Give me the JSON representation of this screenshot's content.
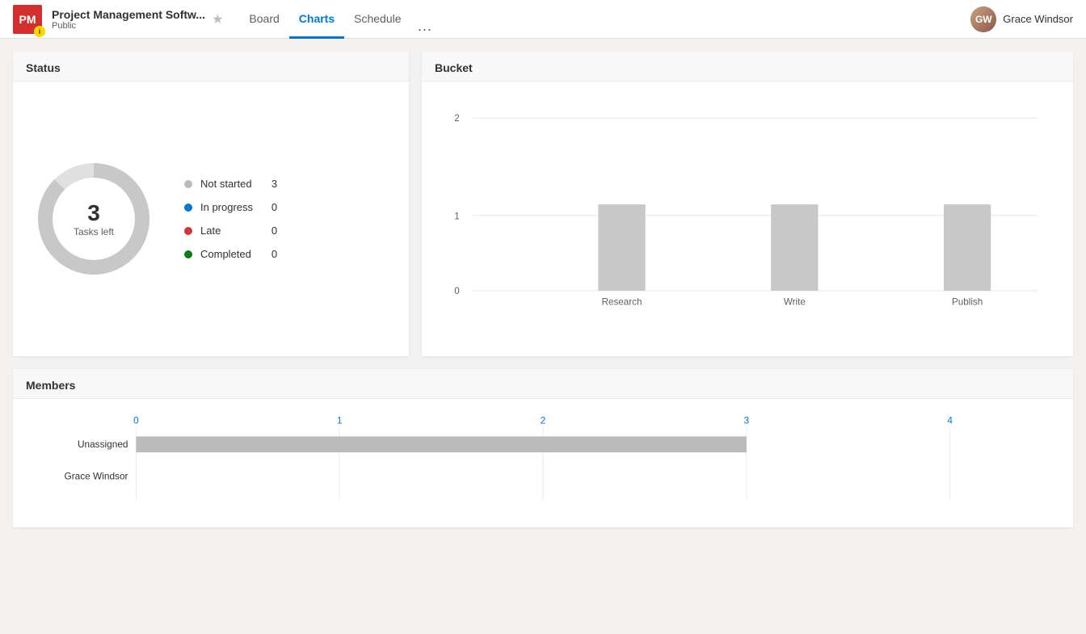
{
  "header": {
    "logo_text": "PM",
    "logo_badge": "i",
    "project_name": "Project Management Softw...",
    "project_visibility": "Public",
    "nav_items": [
      {
        "label": "Board",
        "active": false
      },
      {
        "label": "Charts",
        "active": true
      },
      {
        "label": "Schedule",
        "active": false
      }
    ],
    "more_label": "···",
    "user_name": "Grace Windsor"
  },
  "status_chart": {
    "title": "Status",
    "tasks_left_number": "3",
    "tasks_left_label": "Tasks left",
    "legend": [
      {
        "label": "Not started",
        "count": "3",
        "color": "#bbb"
      },
      {
        "label": "In progress",
        "count": "0",
        "color": "#0078d4"
      },
      {
        "label": "Late",
        "count": "0",
        "color": "#d13438"
      },
      {
        "label": "Completed",
        "count": "0",
        "color": "#107c10"
      }
    ]
  },
  "bucket_chart": {
    "title": "Bucket",
    "y_axis": [
      2,
      1,
      0
    ],
    "bars": [
      {
        "label": "Research",
        "value": 1,
        "max": 2
      },
      {
        "label": "Write",
        "value": 1,
        "max": 2
      },
      {
        "label": "Publish",
        "value": 1,
        "max": 2
      }
    ]
  },
  "members_chart": {
    "title": "Members",
    "x_axis": [
      0,
      1,
      2,
      3,
      4
    ],
    "bars": [
      {
        "label": "Unassigned",
        "value": 3,
        "max": 4
      },
      {
        "label": "Grace Windsor",
        "value": 0,
        "max": 4
      }
    ]
  }
}
